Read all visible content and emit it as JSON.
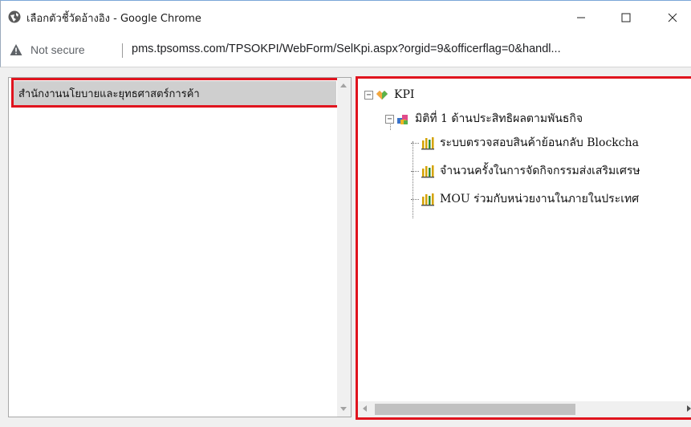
{
  "window": {
    "title": "เลือกตัวชี้วัดอ้างอิง - Google Chrome",
    "controls": [
      "minimize",
      "maximize",
      "close"
    ]
  },
  "address_bar": {
    "security_label": "Not secure",
    "url": "pms.tpsomss.com/TPSOKPI/WebForm/SelKpi.aspx?orgid=9&officerflag=0&handl..."
  },
  "left_panel": {
    "selected_org": "สำนักงานนโยบายและยุทธศาสตร์การค้า"
  },
  "tree": {
    "root": {
      "label": "KPI",
      "expander": "−"
    },
    "dimension": {
      "label": "มิติที่ 1 ด้านประสิทธิผลตามพันธกิจ",
      "expander": "−"
    },
    "items": [
      {
        "label": "ระบบตรวจสอบสินค้าย้อนกลับ Blockcha"
      },
      {
        "label": "จำนวนครั้งในการจัดกิจกรรมส่งเสริมเศรษ"
      },
      {
        "label": "MOU ร่วมกับหน่วยงานในภายในประเทศ"
      }
    ]
  },
  "colors": {
    "highlight": "#e0141e",
    "selection": "#cfcfcf",
    "icon_bar_chart": "#d4a200"
  }
}
